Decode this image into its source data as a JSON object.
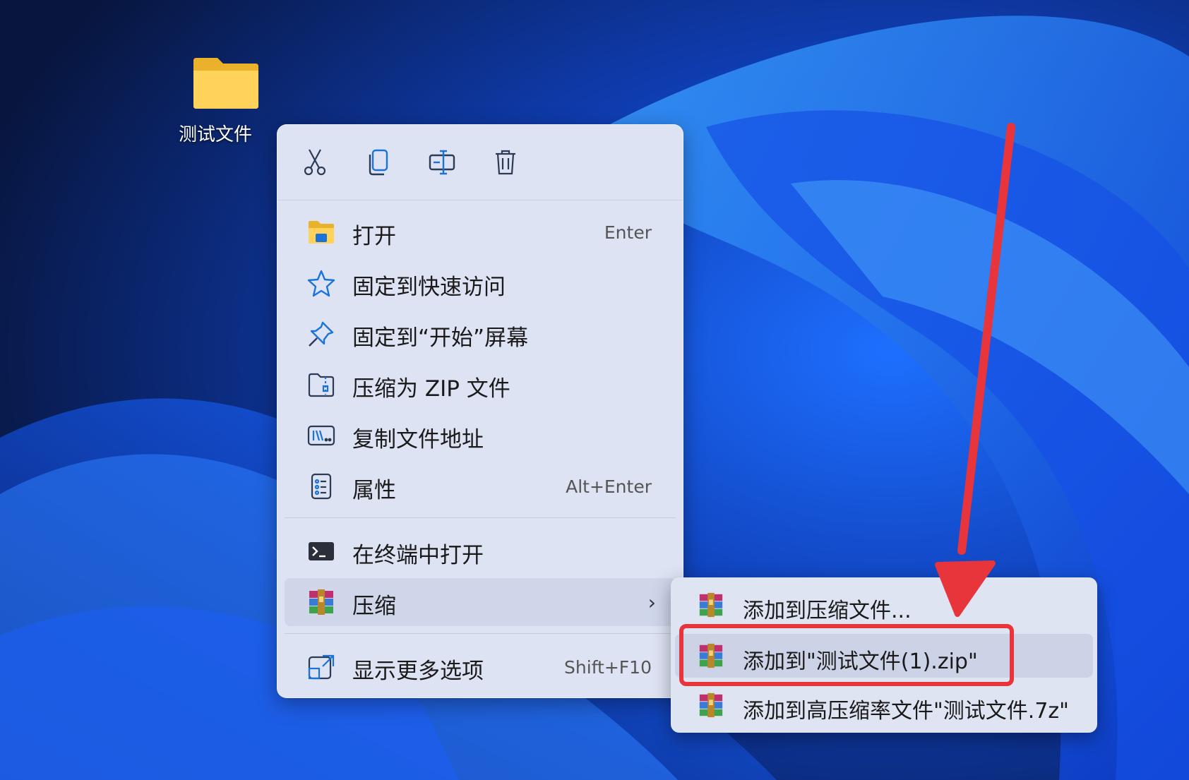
{
  "desktop": {
    "folder_label": "测试文件"
  },
  "toolbar": {
    "cut": "scissors-icon",
    "copy": "copy-icon",
    "rename": "rename-icon",
    "delete": "trash-icon"
  },
  "menu": {
    "items": [
      {
        "label": "打开",
        "shortcut": "Enter"
      },
      {
        "label": "固定到快速访问",
        "shortcut": ""
      },
      {
        "label": "固定到“开始”屏幕",
        "shortcut": ""
      },
      {
        "label": "压缩为 ZIP 文件",
        "shortcut": ""
      },
      {
        "label": "复制文件地址",
        "shortcut": ""
      },
      {
        "label": "属性",
        "shortcut": "Alt+Enter"
      },
      {
        "label": "在终端中打开",
        "shortcut": ""
      },
      {
        "label": "压缩",
        "shortcut": ""
      },
      {
        "label": "显示更多选项",
        "shortcut": "Shift+F10"
      }
    ]
  },
  "submenu": {
    "items": [
      {
        "label": "添加到压缩文件..."
      },
      {
        "label": "添加到\"测试文件(1).zip\""
      },
      {
        "label": "添加到高压缩率文件\"测试文件.7z\""
      }
    ]
  },
  "colors": {
    "annotation": "#e8343b",
    "menu_bg": "#dde3f3"
  }
}
